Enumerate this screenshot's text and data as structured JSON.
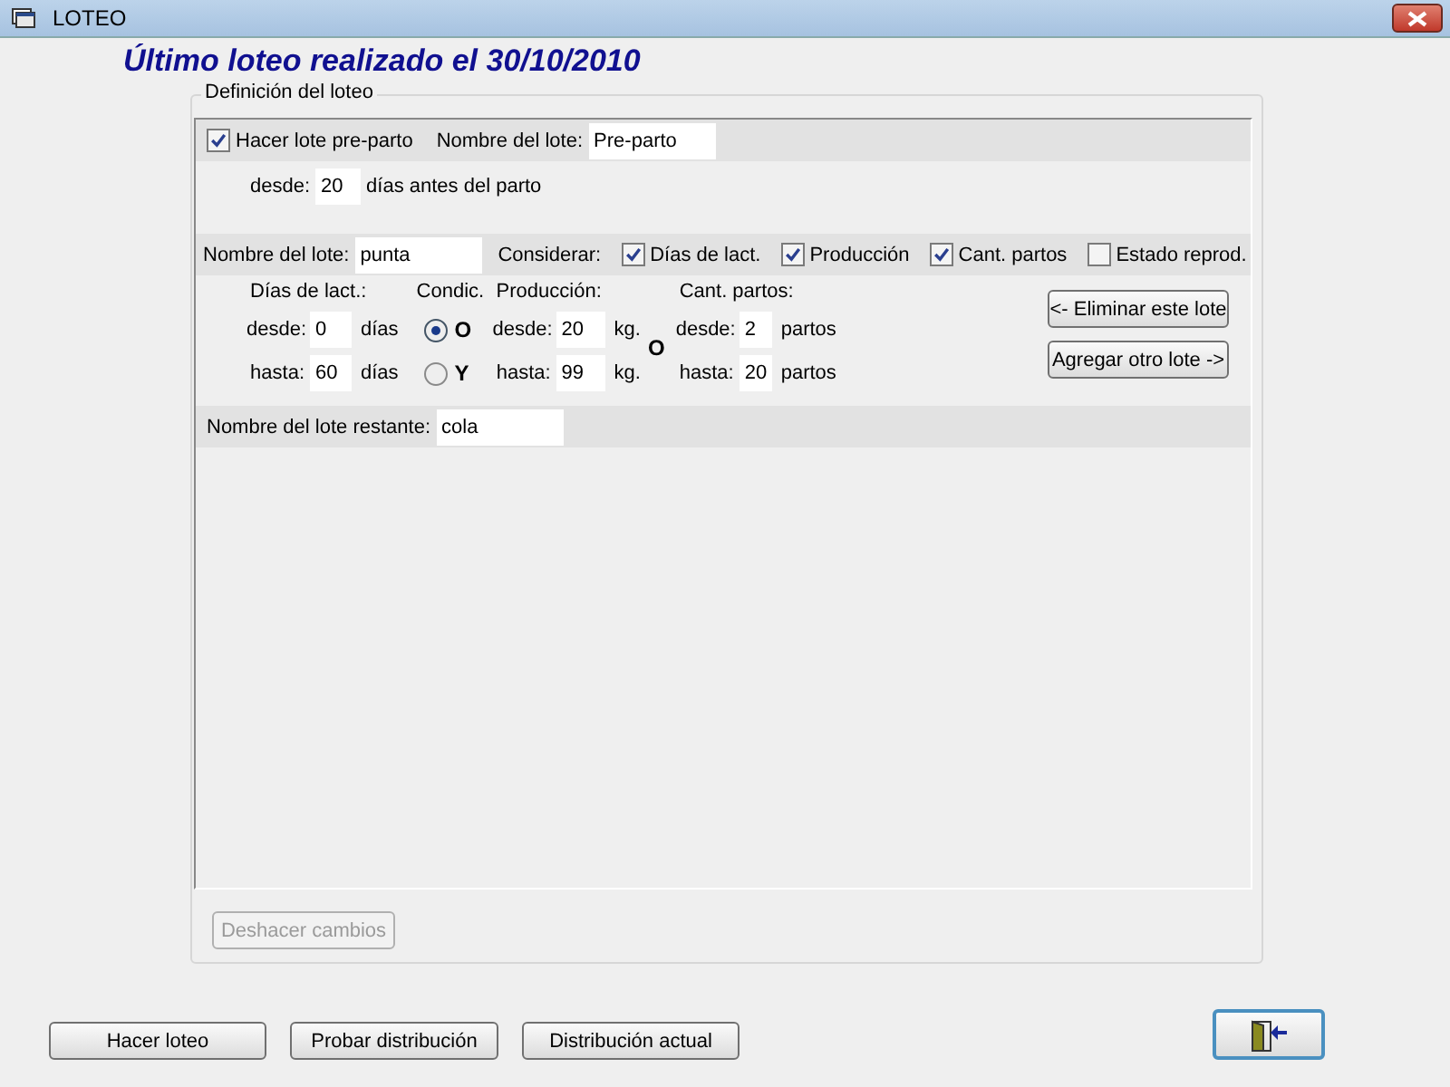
{
  "window": {
    "title": "LOTEO"
  },
  "heading": "Último loteo realizado el 30/10/2010",
  "group": {
    "legend": "Definición del loteo"
  },
  "preparto": {
    "checkbox": {
      "label": "Hacer lote pre-parto",
      "checked": true
    },
    "name_label": "Nombre del lote:",
    "name_value": "Pre-parto",
    "desde_label": "desde:",
    "desde_value": "20",
    "desde_suffix": "días antes del parto"
  },
  "lote": {
    "name_label": "Nombre del lote:",
    "name_value": "punta",
    "considerar_label": "Considerar:",
    "criteria": [
      {
        "label": "Días de lact.",
        "checked": true
      },
      {
        "label": "Producción",
        "checked": true
      },
      {
        "label": "Cant. partos",
        "checked": true
      },
      {
        "label": "Estado reprod.",
        "checked": false
      }
    ],
    "lact": {
      "title": "Días de lact.:",
      "desde_label": "desde:",
      "desde_value": "0",
      "desde_unit": "días",
      "hasta_label": "hasta:",
      "hasta_value": "60",
      "hasta_unit": "días"
    },
    "condic": {
      "title": "Condic.",
      "options": [
        {
          "label": "O",
          "selected": true
        },
        {
          "label": "Y",
          "selected": false
        }
      ]
    },
    "produccion": {
      "title": "Producción:",
      "desde_label": "desde:",
      "desde_value": "20",
      "desde_unit": "kg.",
      "hasta_label": "hasta:",
      "hasta_value": "99",
      "hasta_unit": "kg."
    },
    "joiner": "O",
    "partos": {
      "title": "Cant. partos:",
      "desde_label": "desde:",
      "desde_value": "2",
      "desde_unit": "partos",
      "hasta_label": "hasta:",
      "hasta_value": "20",
      "hasta_unit": "partos"
    },
    "buttons": [
      "<- Eliminar este lote",
      "Agregar otro lote ->"
    ]
  },
  "restante": {
    "label": "Nombre del lote restante:",
    "value": "cola"
  },
  "undo_button": {
    "label": "Deshacer cambios",
    "disabled": true
  },
  "footer_buttons": [
    "Hacer loteo",
    "Probar distribución",
    "Distribución actual"
  ]
}
